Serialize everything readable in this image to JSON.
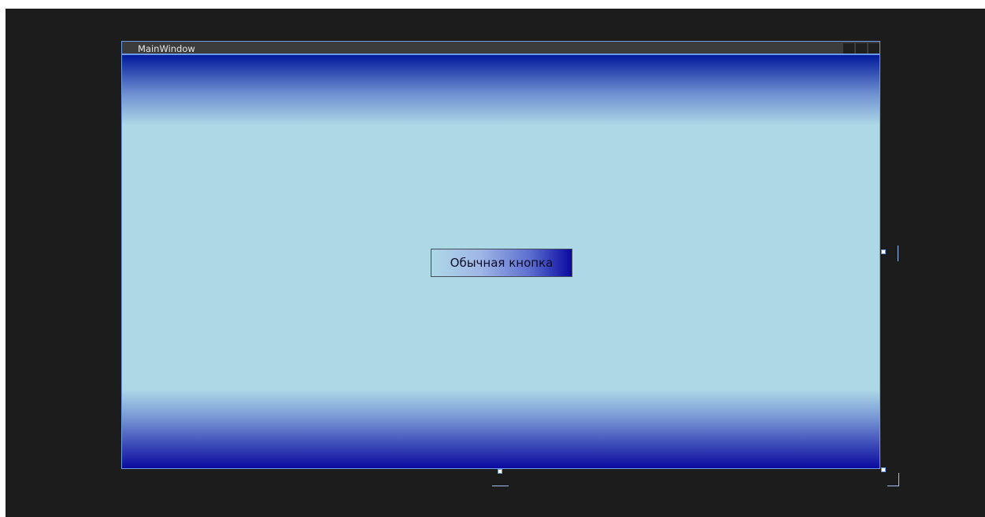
{
  "window": {
    "title": "MainWindow"
  },
  "main": {
    "button_label": "Обычная кнопка"
  },
  "colors": {
    "canvas_background": "#1c1c1c",
    "selection_border": "#6f9be6",
    "client_gradient_edge": "#001a9a",
    "client_gradient_center": "#add8e6",
    "button_gradient_start": "#add8e6",
    "button_gradient_end": "#0a0aa0"
  },
  "icons": {
    "caption_buttons": [
      "minimize-icon",
      "maximize-icon",
      "close-icon"
    ]
  }
}
